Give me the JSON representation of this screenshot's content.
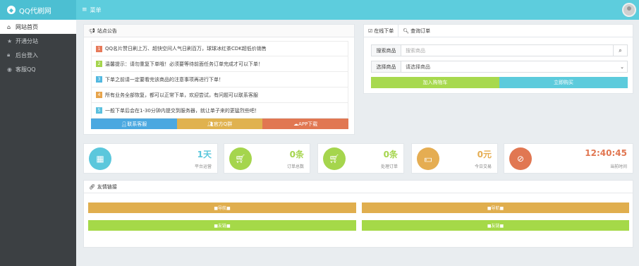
{
  "brand": {
    "title": "QQ代刷网",
    "logo_icon": "qq-penguin-icon"
  },
  "topbar": {
    "menu_label": "菜单",
    "avatar_icon": "user-avatar"
  },
  "sidebar": {
    "items": [
      {
        "icon": "home-icon",
        "glyph": "⌂",
        "label": "网站首页"
      },
      {
        "icon": "star-icon",
        "glyph": "★",
        "label": "开通分站"
      },
      {
        "icon": "lock-icon",
        "glyph": "🔒︎",
        "label": "后台登入"
      },
      {
        "icon": "qq-icon",
        "glyph": "◉",
        "label": "客服QQ"
      }
    ]
  },
  "notice": {
    "title": "站点公告",
    "items": [
      {
        "num": "1",
        "text": "QQ名片赞日刷上万、超快空间人气日刷百万，球球冰红茶CDK超低价销售"
      },
      {
        "num": "2",
        "text": "温馨提示：请勿重复下单哦！必须要等待前面任务订单完成才可以下单！"
      },
      {
        "num": "3",
        "text": "下单之前请一定要看完该商品的注意事项再进行下单！"
      },
      {
        "num": "4",
        "text": "所有业务全部恢复，都可以正常下单，欢迎尝试，有问题可以联系客服"
      },
      {
        "num": "5",
        "text": "一般下单后会在1-30分钟内提交到服务器，就让单子来的更猛烈些吧！"
      }
    ],
    "buttons": {
      "contact": "联系客服",
      "group": "官方Q群",
      "app": "APP下载"
    }
  },
  "order": {
    "tabs": {
      "place": "在线下单",
      "query": "查询订单"
    },
    "search_label": "搜索商品",
    "search_placeholder": "搜索商品",
    "select_label": "选择商品",
    "select_value": "请选择商品",
    "buttons": {
      "cart": "加入购物车",
      "buy": "立即购买"
    }
  },
  "stats": [
    {
      "icon": "calendar-icon",
      "glyph": "▦",
      "color": "#5bc7dc",
      "value": "1天",
      "label": "平台运营"
    },
    {
      "icon": "cart-icon",
      "glyph": "🛒︎",
      "color": "#a5d54d",
      "value": "0条",
      "label": "订单总数"
    },
    {
      "icon": "cart-check-icon",
      "glyph": "🛒︎",
      "color": "#a5d54d",
      "value": "0条",
      "label": "处理订单"
    },
    {
      "icon": "money-icon",
      "glyph": "💵︎",
      "color": "#e5ad52",
      "value": "0元",
      "label": "今日交易"
    },
    {
      "icon": "clock-icon",
      "glyph": "⊘",
      "color": "#e17752",
      "value": "12:40:45",
      "label": "当前时间"
    }
  ],
  "links": {
    "title": "友情链接",
    "items": [
      "■导航■",
      "■导航■",
      "■友链■",
      "■友链■"
    ]
  },
  "colors": {
    "accent": "#5dcddd",
    "sidebar": "#3c4043",
    "orange": "#e0ae4e",
    "green": "#a5d948",
    "red": "#e17752"
  }
}
